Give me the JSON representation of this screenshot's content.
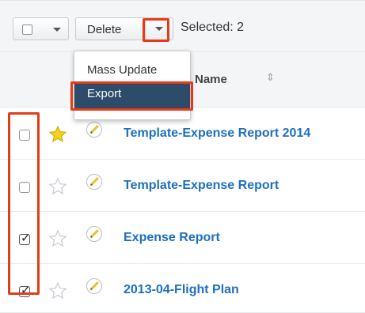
{
  "toolbar": {
    "delete_label": "Delete",
    "selected_label": "Selected: 2"
  },
  "column_header": {
    "name_label": "Name",
    "sort_icon": "⇕"
  },
  "dropdown": {
    "items": [
      {
        "label": "Mass Update",
        "highlighted": false
      },
      {
        "label": "Export",
        "highlighted": true
      }
    ]
  },
  "rows": [
    {
      "name": "Template-Expense Report 2014",
      "checked": false,
      "favorite": true
    },
    {
      "name": "Template-Expense Report",
      "checked": false,
      "favorite": false
    },
    {
      "name": "Expense Report",
      "checked": true,
      "favorite": false
    },
    {
      "name": "2013-04-Flight Plan",
      "checked": true,
      "favorite": false
    }
  ],
  "colors": {
    "link": "#1d6fc1",
    "highlight_border": "#e63b17",
    "menu_active_bg": "#2e4b6a",
    "favorite_star": "#f5d31b"
  },
  "icons": {
    "select_all": "checkbox-icon",
    "caret": "chevron-down-icon",
    "favorite": "star-icon",
    "edit": "pencil-icon"
  }
}
